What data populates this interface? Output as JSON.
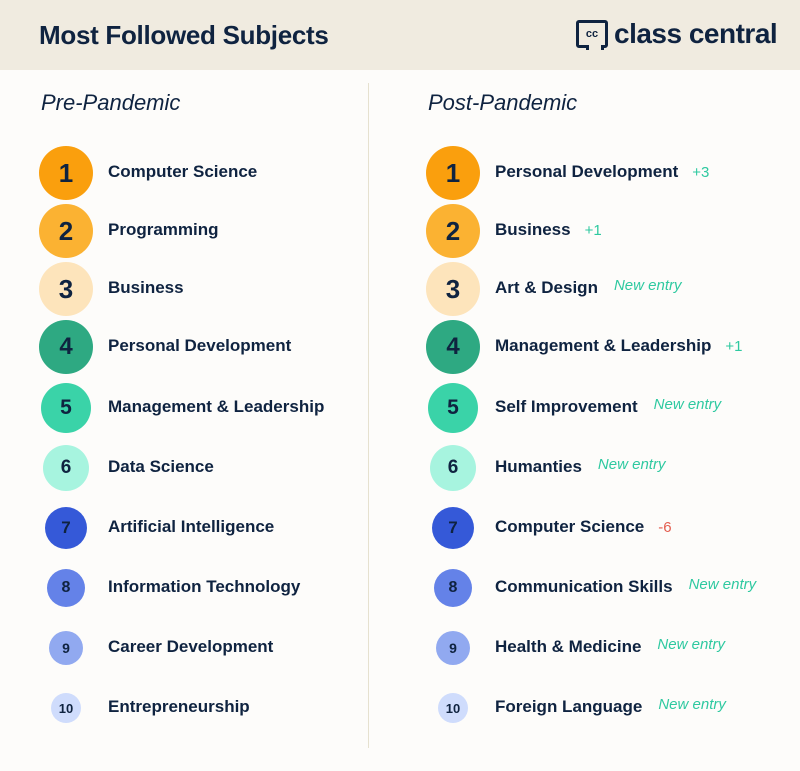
{
  "header": {
    "title": "Most Followed Subjects",
    "logo": {
      "icon_text": "cc",
      "brand": "class central"
    }
  },
  "colors": {
    "rank_1": "#fa9f0d",
    "rank_2": "#fbb232",
    "rank_3": "#fde4bb",
    "rank_4": "#2ea982",
    "rank_5": "#3ad3a8",
    "rank_6": "#a7f4df",
    "rank_7": "#3559d8",
    "rank_8": "#6482e8",
    "rank_9": "#91a9f0",
    "rank_10": "#cfdcfc",
    "positive_change": "#2ec9a0",
    "negative_change": "#e35d4f"
  },
  "pre_pandemic": {
    "heading": "Pre-Pandemic",
    "items": [
      {
        "rank": "1",
        "subject": "Computer Science"
      },
      {
        "rank": "2",
        "subject": "Programming"
      },
      {
        "rank": "3",
        "subject": "Business"
      },
      {
        "rank": "4",
        "subject": "Personal Development"
      },
      {
        "rank": "5",
        "subject": "Management & Leadership"
      },
      {
        "rank": "6",
        "subject": "Data Science"
      },
      {
        "rank": "7",
        "subject": "Artificial Intelligence"
      },
      {
        "rank": "8",
        "subject": "Information Technology"
      },
      {
        "rank": "9",
        "subject": "Career Development"
      },
      {
        "rank": "10",
        "subject": "Entrepreneurship"
      }
    ]
  },
  "post_pandemic": {
    "heading": "Post-Pandemic",
    "items": [
      {
        "rank": "1",
        "subject": "Personal Development",
        "change": "+3",
        "change_type": "up"
      },
      {
        "rank": "2",
        "subject": "Business",
        "change": "+1",
        "change_type": "up"
      },
      {
        "rank": "3",
        "subject": "Art & Design",
        "change": "New entry",
        "change_type": "new"
      },
      {
        "rank": "4",
        "subject": "Management & Leadership",
        "change": "+1",
        "change_type": "up"
      },
      {
        "rank": "5",
        "subject": "Self Improvement",
        "change": "New entry",
        "change_type": "new"
      },
      {
        "rank": "6",
        "subject": "Humanties",
        "change": "New entry",
        "change_type": "new"
      },
      {
        "rank": "7",
        "subject": "Computer Science",
        "change": "-6",
        "change_type": "down"
      },
      {
        "rank": "8",
        "subject": "Communication Skills",
        "change": "New entry",
        "change_type": "new"
      },
      {
        "rank": "9",
        "subject": "Health & Medicine",
        "change": "New entry",
        "change_type": "new"
      },
      {
        "rank": "10",
        "subject": "Foreign Language",
        "change": "New entry",
        "change_type": "new"
      }
    ]
  }
}
